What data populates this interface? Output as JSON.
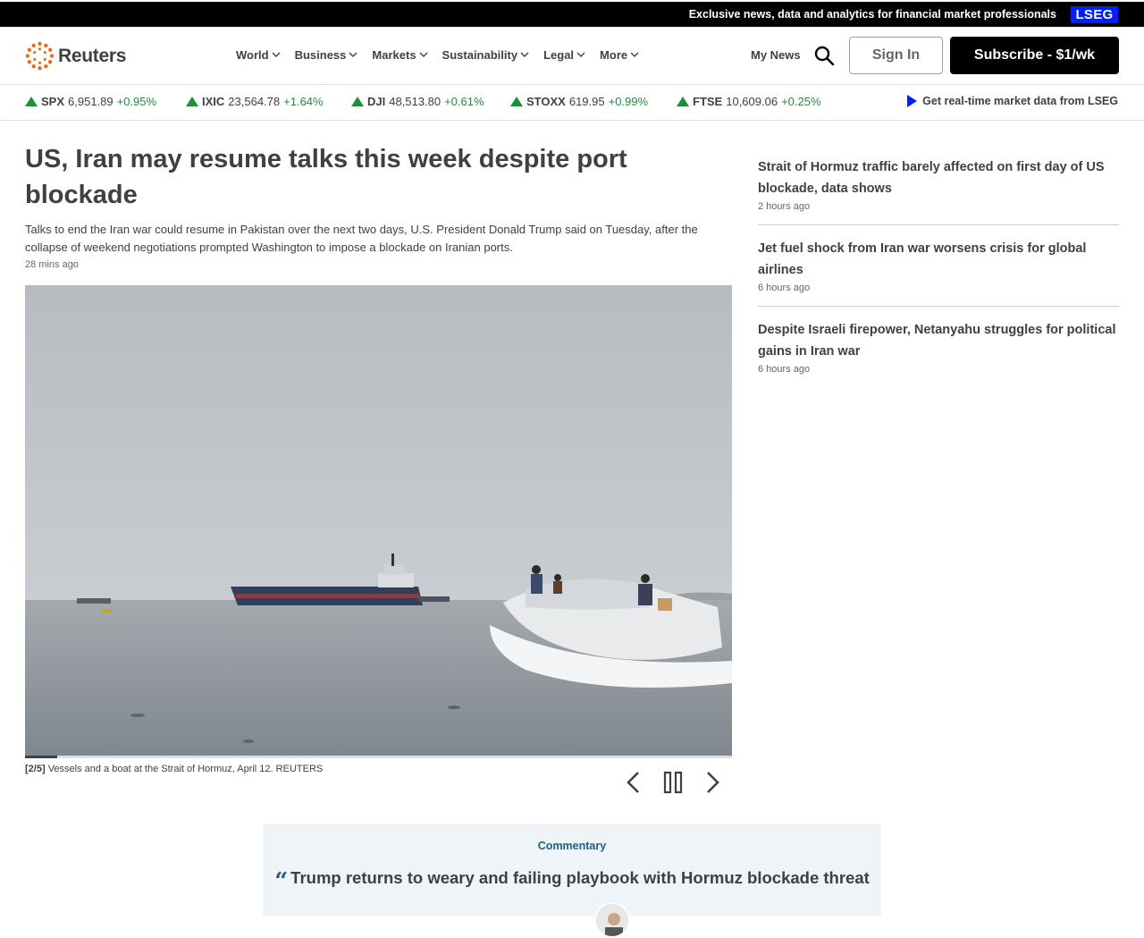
{
  "topbar": {
    "promo": "Exclusive news, data and analytics for financial market professionals",
    "lseg": "LSEG"
  },
  "header": {
    "brand": "Reuters",
    "nav": [
      "World",
      "Business",
      "Markets",
      "Sustainability",
      "Legal",
      "More"
    ],
    "my_news": "My News",
    "sign_in": "Sign In",
    "subscribe": "Subscribe - $1/wk"
  },
  "ticker": [
    {
      "symbol": "SPX",
      "value": "6,951.89",
      "change": "+0.95%"
    },
    {
      "symbol": "IXIC",
      "value": "23,564.78",
      "change": "+1.64%"
    },
    {
      "symbol": "DJI",
      "value": "48,513.80",
      "change": "+0.61%"
    },
    {
      "symbol": "STOXX",
      "value": "619.95",
      "change": "+0.99%"
    },
    {
      "symbol": "FTSE",
      "value": "10,609.06",
      "change": "+0.25%"
    }
  ],
  "ticker_link": "Get real-time market data from LSEG",
  "colors": {
    "up": "#1d8f3b",
    "lseg_blue": "#001eff",
    "commentary_accent": "#1f5f8a"
  },
  "article": {
    "headline": "US, Iran may resume talks this week despite port blockade",
    "summary": "Talks to end the Iran war could resume in Pakistan over the next two days, U.S. President Donald Trump said on Tuesday, after the collapse of weekend negotiations prompted Washington to impose a blockade on Iranian ports.",
    "timestamp": "28 mins ago",
    "gallery": {
      "index": "[2/5]",
      "caption": "Vessels and a boat at the Strait of Hormuz, April 12. REUTERS",
      "progress": 0.046
    }
  },
  "sidebar": [
    {
      "title": "Strait of Hormuz traffic barely affected on first day of US blockade, data shows",
      "time": "2 hours ago"
    },
    {
      "title": "Jet fuel shock from Iran war worsens crisis for global airlines",
      "time": "6 hours ago"
    },
    {
      "title": "Despite Israeli firepower, Netanyahu struggles for political gains in Iran war",
      "time": "6 hours ago"
    }
  ],
  "commentary": {
    "label": "Commentary",
    "title": "Trump returns to weary and failing playbook with Hormuz blockade threat"
  }
}
